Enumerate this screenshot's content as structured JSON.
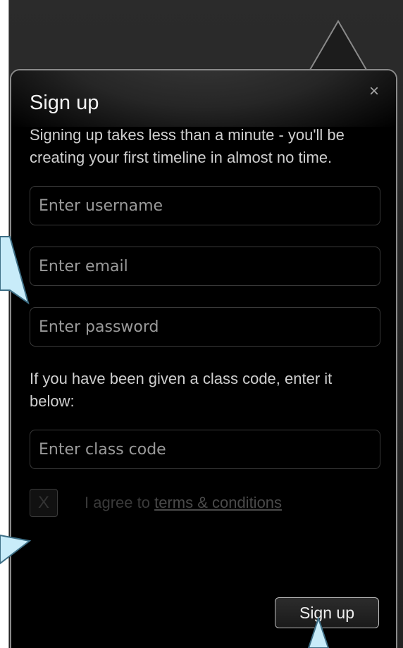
{
  "popup": {
    "title": "Sign up",
    "close_glyph": "×",
    "intro": "Signing up takes less than a minute - you'll be creating your first timeline in almost no time.",
    "username_placeholder": "Enter username",
    "email_placeholder": "Enter email",
    "password_placeholder": "Enter password",
    "class_prompt": "If you have been given a class code, enter it below:",
    "class_code_placeholder": "Enter class code",
    "checkbox_glyph": "X",
    "agree_prefix": "I agree to ",
    "terms_link": "terms & conditions",
    "submit_label": "Sign up"
  },
  "icons": {
    "close": "close-icon",
    "checkbox": "checkbox-x-icon"
  },
  "colors": {
    "popup_background": "#000000",
    "callout_fill": "#c8ecf9",
    "callout_stroke": "#3e6f86",
    "app_background": "#262626"
  }
}
